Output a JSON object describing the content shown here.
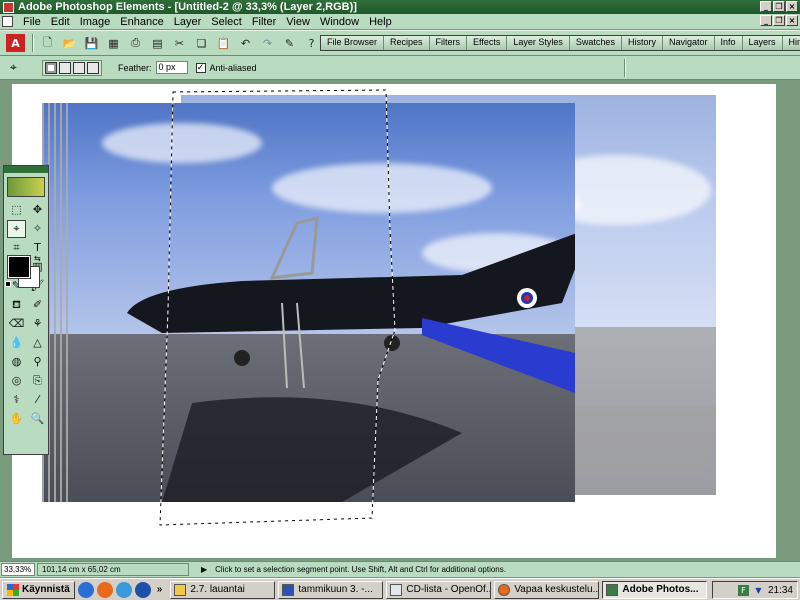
{
  "window": {
    "title": "Adobe Photoshop Elements - [Untitled-2 @ 33,3% (Layer 2,RGB)]",
    "controls": [
      "_",
      "❐",
      "×"
    ]
  },
  "menubar": {
    "items": [
      "File",
      "Edit",
      "Image",
      "Enhance",
      "Layer",
      "Select",
      "Filter",
      "View",
      "Window",
      "Help"
    ]
  },
  "palette_well": {
    "tabs": [
      "File Browser",
      "Recipes",
      "Filters",
      "Effects",
      "Layer Styles",
      "Swatches",
      "History",
      "Navigator",
      "Info",
      "Layers",
      "Hints"
    ]
  },
  "options": {
    "feather_label": "Feather:",
    "feather_value": "0 px",
    "anti_aliased_label": "Anti-aliased",
    "anti_aliased_checked": true
  },
  "status": {
    "zoom": "33,33%",
    "doc_size": "101,14 cm x 65,02 cm",
    "hint": "Click to set a selection segment point.  Use Shift, Alt and Ctrl for additional options."
  },
  "colors": {
    "foreground": "#000000",
    "background": "#ffffff",
    "accent": "#b9dcc0"
  },
  "taskbar": {
    "start_label": "Käynnistä",
    "buttons": [
      {
        "label": "2.7. lauantai",
        "icon": "folder-icon"
      },
      {
        "label": "tammikuun 3. -...",
        "icon": "word-icon"
      },
      {
        "label": "CD-lista - OpenOf...",
        "icon": "calc-icon"
      },
      {
        "label": "Vapaa keskustelu...",
        "icon": "firefox-icon"
      },
      {
        "label": "Adobe Photos...",
        "icon": "photoshop-icon"
      }
    ],
    "clock": "21:34",
    "chevron": "»"
  }
}
